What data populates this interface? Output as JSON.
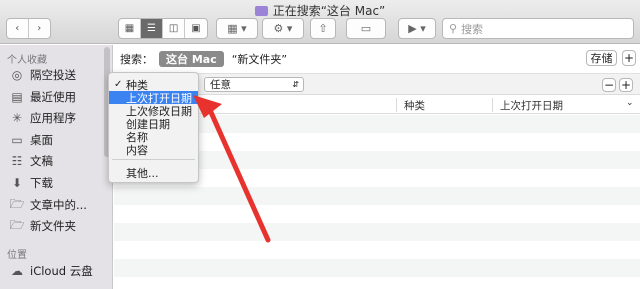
{
  "window": {
    "title": "正在搜索“这台 Mac”"
  },
  "toolbar": {
    "search_placeholder": "搜索"
  },
  "sidebar": {
    "favorites_header": "个人收藏",
    "items": [
      {
        "label": "隔空投送",
        "icon": "airdrop-icon"
      },
      {
        "label": "最近使用",
        "icon": "recents-icon"
      },
      {
        "label": "应用程序",
        "icon": "applications-icon"
      },
      {
        "label": "桌面",
        "icon": "desktop-icon"
      },
      {
        "label": "文稿",
        "icon": "documents-icon"
      },
      {
        "label": "下载",
        "icon": "downloads-icon"
      },
      {
        "label": "文章中的...",
        "icon": "folder-icon"
      },
      {
        "label": "新文件夹",
        "icon": "folder-icon"
      }
    ],
    "locations_header": "位置",
    "locations": [
      {
        "label": "iCloud 云盘",
        "icon": "cloud-icon"
      }
    ]
  },
  "search_scope": {
    "label": "搜索：",
    "this_mac": "这台 Mac",
    "folder": "“新文件夹”",
    "save_label": "存储"
  },
  "criteria": {
    "value": "任意",
    "remove": "−",
    "add": "+"
  },
  "columns": {
    "kind": "种类",
    "last_opened": "上次打开日期"
  },
  "menu": {
    "items": [
      "种类",
      "上次打开日期",
      "上次修改日期",
      "创建日期",
      "名称",
      "内容",
      "其他..."
    ],
    "checked": "种类",
    "highlighted": "上次打开日期"
  },
  "colors": {
    "highlight": "#3b83f0",
    "arrow": "#e8322e"
  }
}
